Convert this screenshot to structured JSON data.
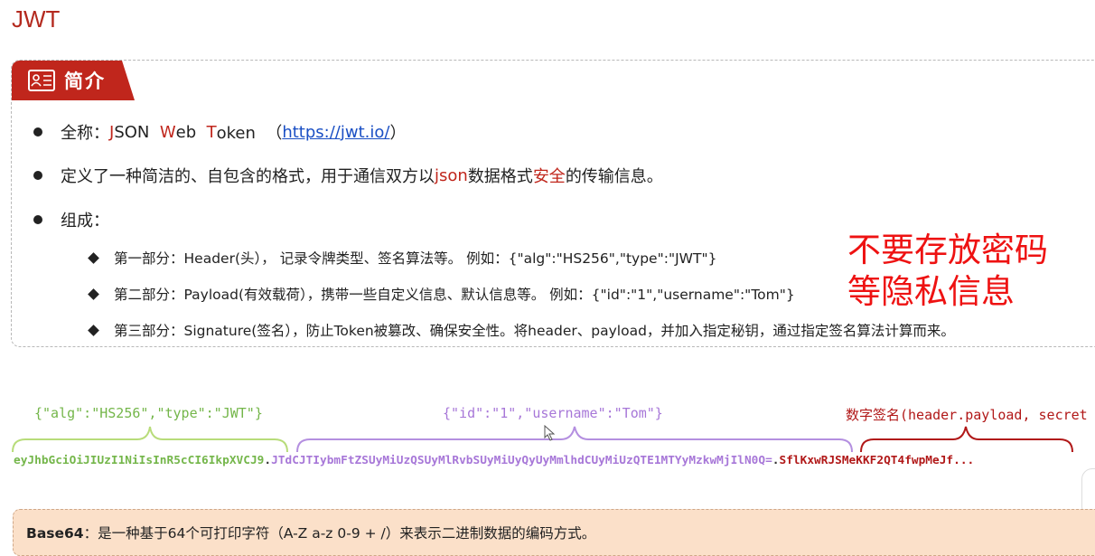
{
  "page": {
    "title": "JWT"
  },
  "intro": {
    "tab_label": "简介",
    "bullets": [
      {
        "prefix": "全称：",
        "j": "J",
        "son": "SON  ",
        "w": "W",
        "eb": "eb  ",
        "t": "T",
        "oken": "oken  （",
        "link": "https://jwt.io/",
        "suffix": "）"
      },
      {
        "before": "定义了一种简洁的、自包含的格式，用于通信双方以",
        "json": "json",
        "middle": "数据格式",
        "safe": "安全",
        "after": "的传输信息。"
      },
      {
        "text": "组成："
      }
    ],
    "sub_items": [
      "第一部分：Header(头）， 记录令牌类型、签名算法等。 例如：{\"alg\":\"HS256\",\"type\":\"JWT\"}",
      "第二部分：Payload(有效载荷），携带一些自定义信息、默认信息等。 例如：{\"id\":\"1\",\"username\":\"Tom\"}",
      "第三部分：Signature(签名），防止Token被篡改、确保安全性。将header、payload，并加入指定秘钥，通过指定签名算法计算而来。"
    ],
    "note_line1": "不要存放密码",
    "note_line2": "等隐私信息"
  },
  "token": {
    "header_label": "{\"alg\":\"HS256\",\"type\":\"JWT\"}",
    "payload_label": "{\"id\":\"1\",\"username\":\"Tom\"}",
    "signature_label": "数字签名(header.payload, secret",
    "header_encoded": "eyJhbGciOiJIUzI1NiIsInR5cCI6IkpXVCJ9",
    "payload_encoded": "JTdCJTIybmFtZSUyMiUzQSUyMlRvbSUyMiUyQyUyMmlhdCUyMiUzQTE1MTYyMzkwMjIlN0Q=",
    "signature_encoded": "SflKxwRJSMeKKF2QT4fwpMeJf...",
    "dot": "."
  },
  "base64": {
    "term": "Base64",
    "definition": "：是一种基于64个可打印字符（A-Z a-z 0-9 + /）来表示二进制数据的编码方式。"
  },
  "colors": {
    "brand_red": "#c0261c",
    "note_red": "#ee1212",
    "header_green": "#74b64a",
    "payload_purple": "#a777d8",
    "signature_red": "#b11818",
    "base64_bg": "#fbe0c9"
  }
}
